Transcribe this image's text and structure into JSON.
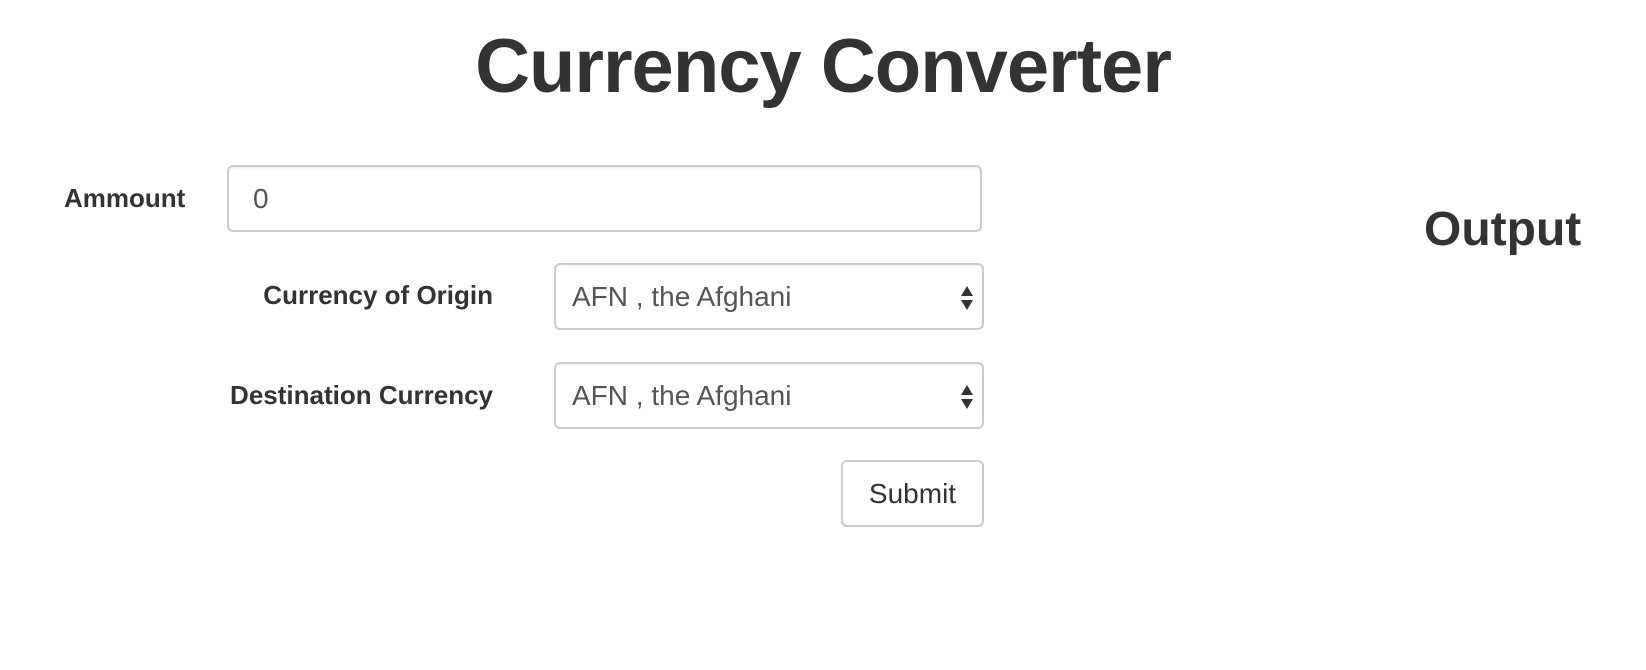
{
  "page": {
    "title": "Currency Converter"
  },
  "form": {
    "amount": {
      "label": "Ammount",
      "value": "0"
    },
    "origin": {
      "label": "Currency of Origin",
      "selected": "AFN , the Afghani"
    },
    "destination": {
      "label": "Destination Currency",
      "selected": "AFN , the Afghani"
    },
    "submit_label": "Submit"
  },
  "output": {
    "heading": "Output"
  },
  "icons": {
    "select_arrow": "up-down-caret-icon"
  },
  "colors": {
    "text": "#333333",
    "input_text": "#555555",
    "border": "#cccccc"
  }
}
